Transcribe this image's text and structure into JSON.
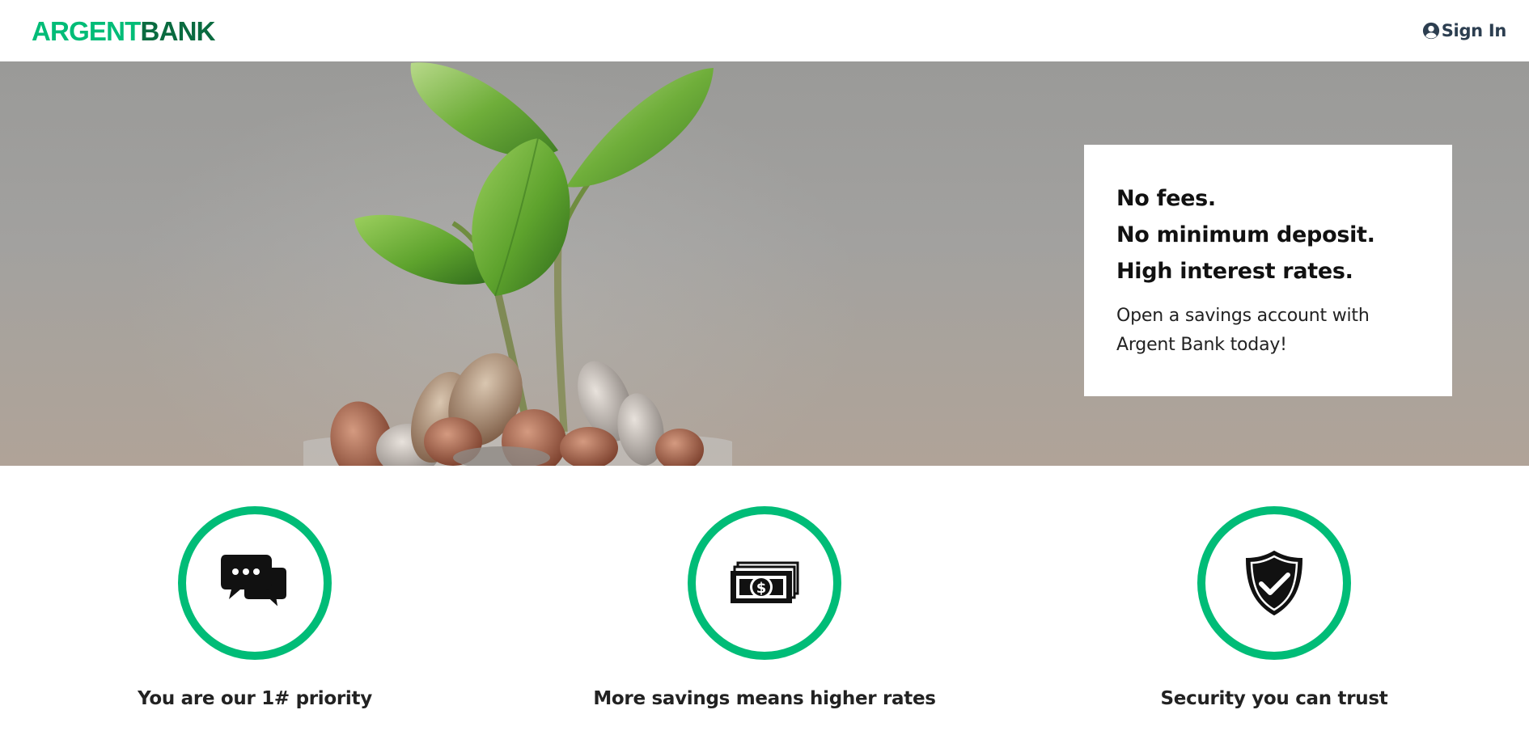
{
  "header": {
    "logo_part1": "ARGENT",
    "logo_part2": "BANK",
    "signin_label": "Sign In",
    "signin_icon": "user-circle-icon"
  },
  "hero": {
    "lines": [
      "No fees.",
      "No minimum deposit.",
      "High interest rates."
    ],
    "text": "Open a savings account with Argent Bank today!",
    "image": "plant-growing-from-coins-jar"
  },
  "features": [
    {
      "icon": "chat-icon",
      "title": "You are our 1# priority"
    },
    {
      "icon": "money-icon",
      "title": "More savings means higher rates"
    },
    {
      "icon": "security-shield-icon",
      "title": "Security you can trust"
    }
  ],
  "colors": {
    "brand_green": "#00bc77",
    "brand_dark_green": "#0a6b40",
    "nav_text": "#2c3e50"
  }
}
